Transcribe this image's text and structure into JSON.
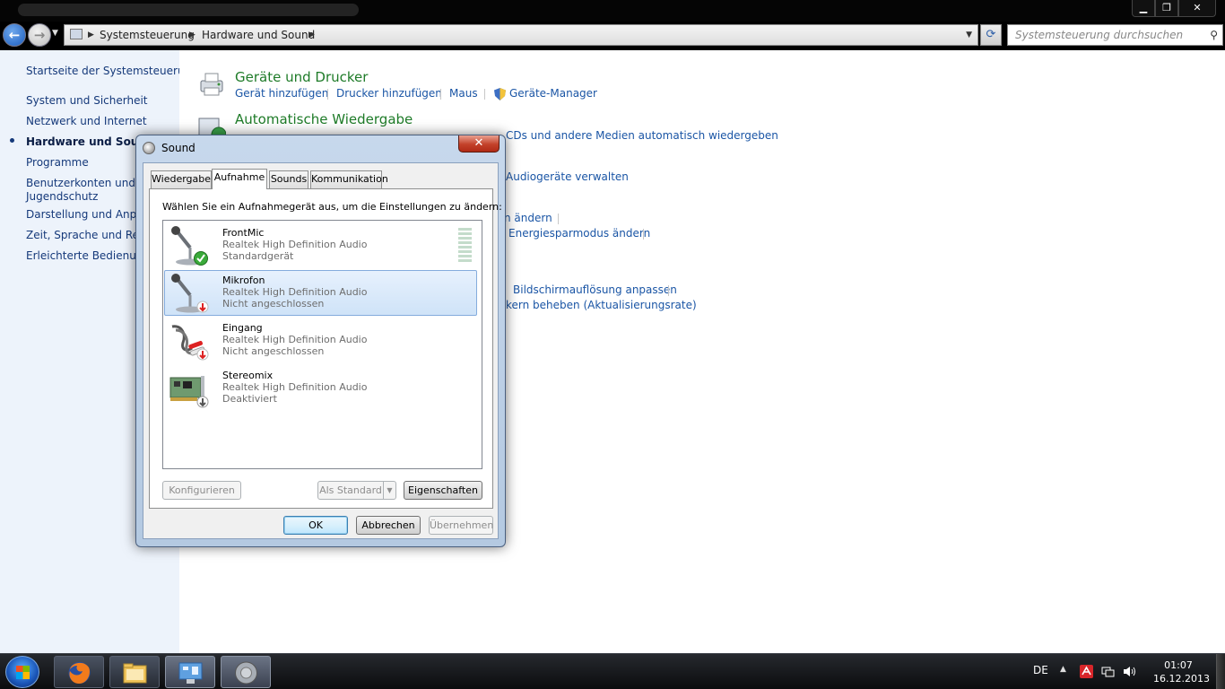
{
  "window": {
    "min_icon": "minimize-glyph",
    "max_icon": "maximize-glyph",
    "close_icon": "close-glyph"
  },
  "addressbar": {
    "crumbs": [
      "Systemsteuerung",
      "Hardware und Sound"
    ],
    "search_placeholder": "Systemsteuerung durchsuchen"
  },
  "sidebar": {
    "home": "Startseite der Systemsteuerung",
    "items": [
      {
        "label": "System und Sicherheit",
        "current": false
      },
      {
        "label": "Netzwerk und Internet",
        "current": false
      },
      {
        "label": "Hardware und Sound",
        "current": true
      },
      {
        "label": "Programme",
        "current": false
      },
      {
        "label": "Benutzerkonten und\nJugendschutz",
        "current": false
      },
      {
        "label": "Darstellung und Anpas",
        "current": false
      },
      {
        "label": "Zeit, Sprache und Regi",
        "current": false
      },
      {
        "label": "Erleichterte Bedienung",
        "current": false
      }
    ]
  },
  "main": {
    "devices": {
      "title": "Geräte und Drucker",
      "tasks": [
        "Gerät hinzufügen",
        "Drucker hinzufügen",
        "Maus",
        "Geräte-Manager"
      ]
    },
    "autoplay": {
      "title": "Automatische Wiedergabe",
      "task_visible": "CDs und andere Medien automatisch wiedergeben"
    },
    "sound_task_visible": "Audiogeräte verwalten",
    "power_tasks_visible": [
      "n ändern",
      "Energiesparmodus ändern"
    ],
    "display_tasks_visible": [
      "Bildschirmauflösung anpassen",
      "kern beheben (Aktualisierungsrate)"
    ]
  },
  "dialog": {
    "title": "Sound",
    "close_label": "✕",
    "tabs": [
      "Wiedergabe",
      "Aufnahme",
      "Sounds",
      "Kommunikation"
    ],
    "selected_tab": "Aufnahme",
    "prompt": "Wählen Sie ein Aufnahmegerät aus, um die Einstellungen zu ändern:",
    "devices": [
      {
        "name": "FrontMic",
        "driver": "Realtek High Definition Audio",
        "status": "Standardgerät",
        "icon": "microphone-default-icon",
        "badge": "green-check"
      },
      {
        "name": "Mikrofon",
        "driver": "Realtek High Definition Audio",
        "status": "Nicht angeschlossen",
        "icon": "microphone-unplugged-icon",
        "badge": "red-arrow"
      },
      {
        "name": "Eingang",
        "driver": "Realtek High Definition Audio",
        "status": "Nicht angeschlossen",
        "icon": "rca-cable-icon",
        "badge": "red-arrow"
      },
      {
        "name": "Stereomix",
        "driver": "Realtek High Definition Audio",
        "status": "Deaktiviert",
        "icon": "soundcard-icon",
        "badge": "grey-arrow"
      }
    ],
    "selected_device": "Mikrofon",
    "buttons": {
      "configure": "Konfigurieren",
      "set_default": "Als Standard",
      "properties": "Eigenschaften",
      "ok": "OK",
      "cancel": "Abbrechen",
      "apply": "Übernehmen"
    }
  },
  "taskbar": {
    "items": [
      "start-orb",
      "firefox-icon",
      "explorer-icon",
      "control-panel-icon",
      "sound-icon"
    ],
    "language": "DE",
    "time": "01:07",
    "date": "16.12.2013"
  },
  "colors": {
    "link": "#1a55a5",
    "category": "#1e7b28",
    "sidebar_bg": "#edf3fb",
    "selection": "#cfe3f8"
  }
}
